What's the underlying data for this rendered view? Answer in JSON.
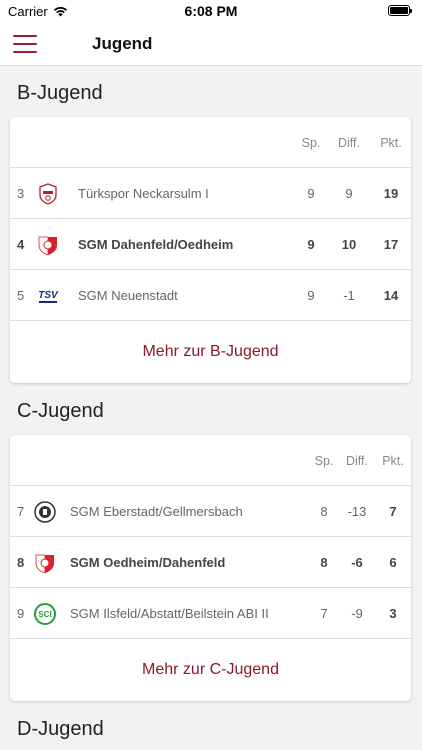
{
  "status_bar": {
    "carrier": "Carrier",
    "time": "6:08 PM"
  },
  "nav": {
    "title": "Jugend"
  },
  "colors": {
    "accent": "#a3172e",
    "link": "#8a1a2a"
  },
  "sections": [
    {
      "title": "B-Jugend",
      "headers": {
        "sp": "Sp.",
        "diff": "Diff.",
        "pkt": "Pkt."
      },
      "rows": [
        {
          "rank": "3",
          "team": "Türkspor Neckarsulm I",
          "sp": "9",
          "diff": "9",
          "pkt": "19",
          "logo": "tuerkspor-logo-icon"
        },
        {
          "rank": "4",
          "team": "SGM Dahenfeld/Oedheim",
          "sp": "9",
          "diff": "10",
          "pkt": "17",
          "logo": "red-white-shield-logo-icon"
        },
        {
          "rank": "5",
          "team": "SGM Neuenstadt",
          "sp": "9",
          "diff": "-1",
          "pkt": "14",
          "logo": "tsv-neuenstadt-logo-icon"
        }
      ],
      "more": "Mehr zur B-Jugend"
    },
    {
      "title": "C-Jugend",
      "headers": {
        "sp": "Sp.",
        "diff": "Diff.",
        "pkt": "Pkt."
      },
      "rows": [
        {
          "rank": "7",
          "team": "SGM Eberstadt/Gellmersbach",
          "sp": "8",
          "diff": "-13",
          "pkt": "7",
          "logo": "eberstadt-logo-icon"
        },
        {
          "rank": "8",
          "team": "SGM Oedheim/Dahenfeld",
          "sp": "8",
          "diff": "-6",
          "pkt": "6",
          "logo": "red-white-shield-logo-icon"
        },
        {
          "rank": "9",
          "team": "SGM Ilsfeld/Abstatt/Beilstein ABI II",
          "sp": "7",
          "diff": "-9",
          "pkt": "3",
          "logo": "sci-logo-icon"
        }
      ],
      "more": "Mehr zur C-Jugend"
    },
    {
      "title": "D-Jugend"
    }
  ]
}
